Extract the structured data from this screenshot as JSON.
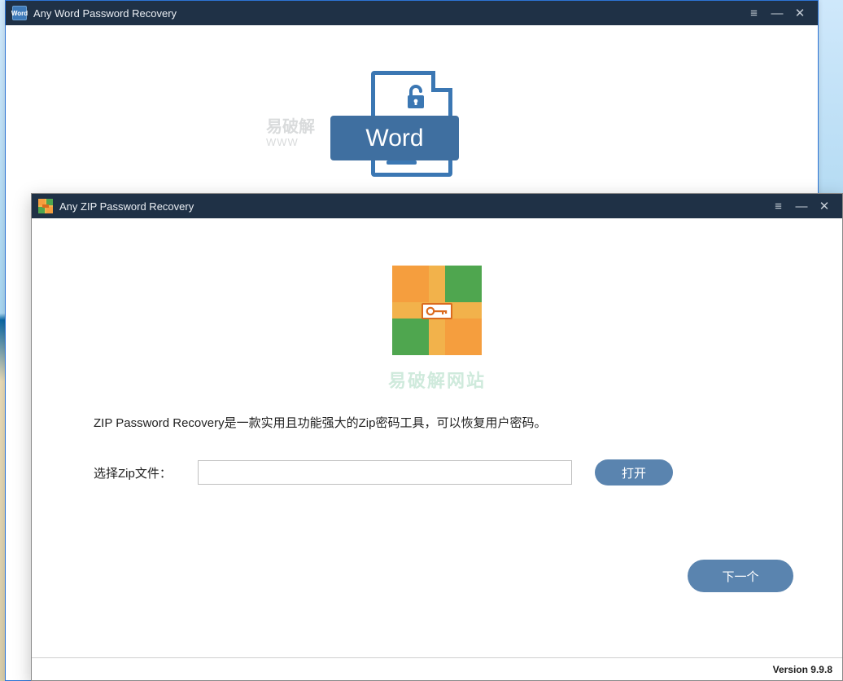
{
  "wordWindow": {
    "title": "Any Word Password Recovery",
    "badgeText": "Word",
    "illus_label": "Word",
    "watermark_cn": "易破解",
    "watermark_en": "WWW"
  },
  "zipWindow": {
    "title": "Any ZIP Password Recovery",
    "watermark": "易破解网站",
    "description": "ZIP Password Recovery是一款实用且功能强大的Zip密码工具，可以恢复用户密码。",
    "selectLabel": "选择Zip文件：",
    "filePath": "",
    "openButton": "打开",
    "nextButton": "下一个",
    "version": "Version 9.9.8"
  },
  "titlebarIcons": {
    "menu": "≡",
    "minimize": "—",
    "close": "✕"
  }
}
